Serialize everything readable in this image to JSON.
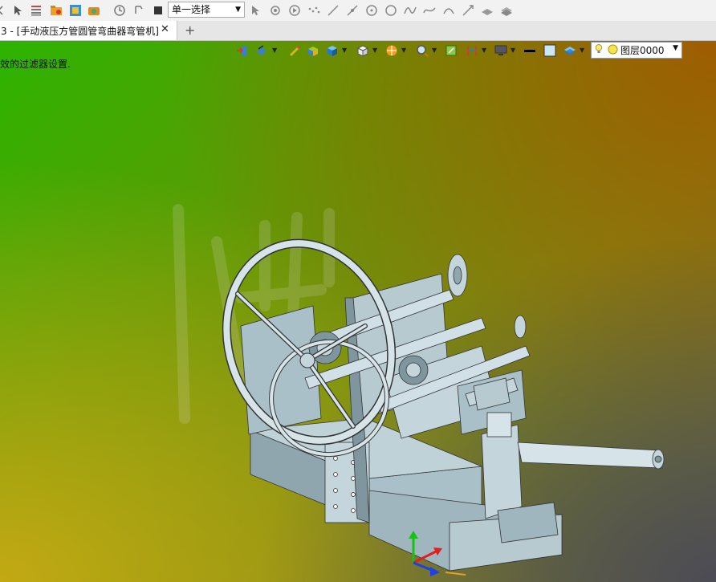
{
  "toolbar": {
    "select_mode": "单一选择",
    "icons": [
      "arrow-cursor-icon",
      "list-icon",
      "open-folder-icon",
      "cube-image-icon",
      "camera-icon",
      "history-icon",
      "undo-icon",
      "stop-icon"
    ],
    "tools": [
      "pick-icon",
      "snap-icon",
      "play-icon",
      "points-icon",
      "line-icon",
      "line-point-icon",
      "circle-center-icon",
      "circle-icon",
      "spline-icon",
      "curve-icon",
      "arc-icon",
      "construct-line-icon",
      "plane-icon",
      "stack-icon"
    ]
  },
  "tab": {
    "title": "3 - [手动液压方管圆管弯曲器弯管机]",
    "close": "✕",
    "new": "+"
  },
  "viewport": {
    "hint": "效的过滤器设置.",
    "layer": "图层0000",
    "colors": {
      "green": "#2cb400",
      "orange": "#a05a00",
      "yellow": "#c8aa14",
      "model": "#a9c0c8"
    }
  }
}
